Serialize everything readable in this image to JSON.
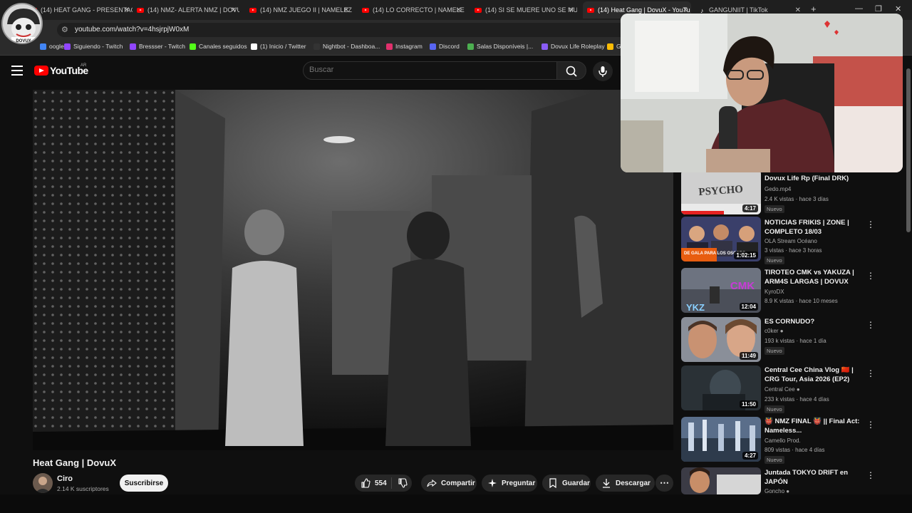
{
  "browser": {
    "tabs": [
      {
        "title": "(14) HEAT GANG - PRESENTACI",
        "icon": "youtube-icon"
      },
      {
        "title": "(14) NMZ- ALERTA NMZ | DOVU",
        "icon": "youtube-icon"
      },
      {
        "title": "(14) NMZ JUEGO II | NAMELEZ",
        "icon": "youtube-icon"
      },
      {
        "title": "(14) LO CORRECTO | NAMELEZ",
        "icon": "youtube-icon"
      },
      {
        "title": "(14) SI SE MUERE UNO SE MUE",
        "icon": "youtube-icon"
      },
      {
        "title": "(14) Heat Gang | DovuX - YouTu",
        "icon": "youtube-icon"
      },
      {
        "title": "GANGUNIIT | TikTok",
        "icon": "tiktok-icon"
      }
    ],
    "new_tab": "+",
    "url": "youtube.com/watch?v=4hsjrpjW0xM",
    "bookmarks": [
      {
        "label": "oogle",
        "color": "#4285f4"
      },
      {
        "label": "Siguiendo - Twitch",
        "color": "#9146ff"
      },
      {
        "label": "Bressser - Twitch",
        "color": "#9146ff"
      },
      {
        "label": "Canales seguidos",
        "color": "#53fc18"
      },
      {
        "label": "(1) Inicio / Twitter",
        "color": "#ffffff"
      },
      {
        "label": "Nightbot - Dashboa...",
        "color": "#333333"
      },
      {
        "label": "Instagram",
        "color": "#e1306c"
      },
      {
        "label": "Discord",
        "color": "#5865f2"
      },
      {
        "label": "Salas Disponíveis |...",
        "color": "#4caf50"
      },
      {
        "label": "Dovux Life Roleplay",
        "color": "#8a5cf6"
      },
      {
        "label": "G",
        "color": "#fbbc05"
      }
    ]
  },
  "youtube": {
    "logo_text": "YouTube",
    "country": "AR",
    "search_placeholder": "Buscar"
  },
  "video": {
    "title": "Heat Gang | DovuX",
    "channel": "Ciro",
    "subscribers": "2.14 K suscriptores",
    "subscribe_label": "Suscribirse",
    "likes": "554",
    "share_label": "Compartir",
    "ask_label": "Preguntar",
    "save_label": "Guardar",
    "download_label": "Descargar"
  },
  "recommendations": [
    {
      "title": "Dovux Life Rp (Final DRK)",
      "channel": "Gedo.mp4",
      "meta": "2.4 K vistas · hace 3 días",
      "badge": "Nuevo",
      "duration": "4:17",
      "verified": false
    },
    {
      "title": "NOTICIAS FRIKIS | ZONE | COMPLETO 18/03",
      "channel": "OLA Stream Océano",
      "meta": "3 vistas · hace 3 horas",
      "badge": "Nuevo",
      "duration": "1:02:15",
      "verified": false
    },
    {
      "title": "TIROTEO CMK vs YAKUZA | ARM4S LARGAS | DOVUX LIFE...",
      "channel": "KyroDX",
      "meta": "8.9 K vistas · hace 10 meses",
      "badge": "",
      "duration": "12:04",
      "verified": false
    },
    {
      "title": "ES CORNUDO?",
      "channel": "c0ker",
      "meta": "193 k vistas · hace 1 día",
      "badge": "Nuevo",
      "duration": "11:49",
      "verified": true
    },
    {
      "title": "Central Cee China Vlog 🇨🇳 | CRG Tour, Asia 2026 (EP2)",
      "channel": "Central Cee",
      "meta": "233 k vistas · hace 4 días",
      "badge": "Nuevo",
      "duration": "11:50",
      "verified": true
    },
    {
      "title": "👹 NMZ FINAL 👹 || Final Act: Nameless...",
      "channel": "Camello Prod.",
      "meta": "809 vistas · hace 4 días",
      "badge": "Nuevo",
      "duration": "4:27",
      "verified": false
    },
    {
      "title": "Juntada TOKYO DRIFT en JAPÓN",
      "channel": "Goncho",
      "meta": "",
      "badge": "",
      "duration": "",
      "verified": true
    }
  ],
  "thumb_overlay": {
    "psycho": "PSYCHO",
    "oscars": "DE GALA PARA LOS OSCARS",
    "cmk": "CMK",
    "ykz": "YKZ"
  },
  "overlay_avatar_text": "DOVUX"
}
